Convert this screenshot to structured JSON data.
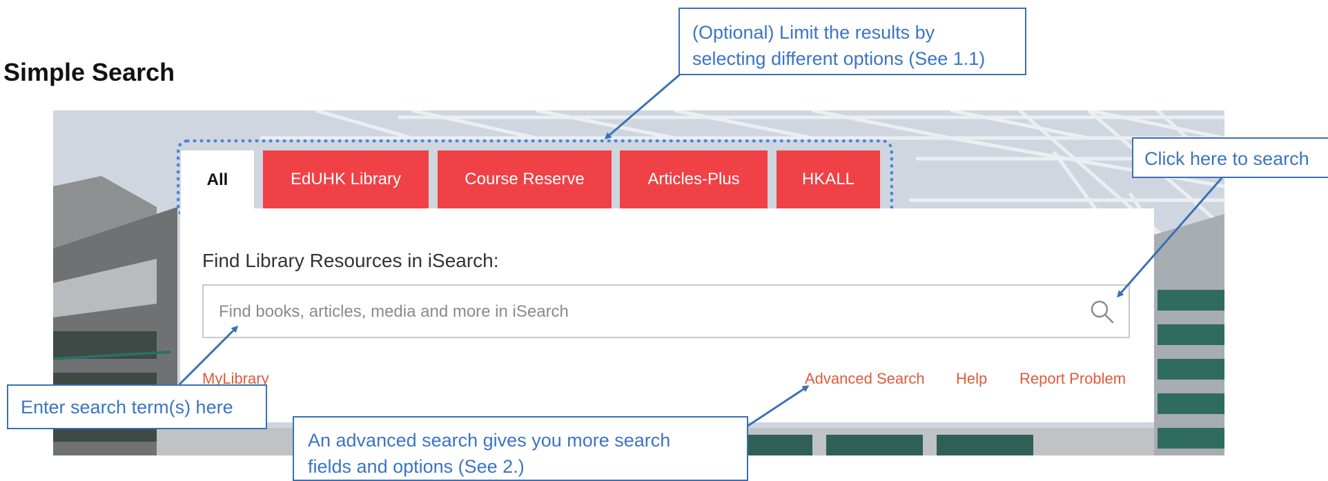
{
  "heading": "Simple Search",
  "tabs": [
    {
      "label": "All",
      "active": true
    },
    {
      "label": "EdUHK Library",
      "active": false
    },
    {
      "label": "Course Reserve",
      "active": false
    },
    {
      "label": "Articles-Plus",
      "active": false
    },
    {
      "label": "HKALL",
      "active": false
    }
  ],
  "search": {
    "label": "Find Library Resources in iSearch:",
    "placeholder": "Find books, articles, media and more in iSearch",
    "value": ""
  },
  "links": {
    "my_library": "MyLibrary",
    "advanced_search": "Advanced Search",
    "help": "Help",
    "report_problem": "Report Problem"
  },
  "callouts": {
    "limit_line1": "(Optional) Limit the results by",
    "limit_line2": "selecting different options (See 1.1)",
    "search_button": "Click here to search",
    "search_term": "Enter search term(s) here",
    "advanced_line1": " An advanced search gives you more search",
    "advanced_line2": "fields and options (See 2.)"
  },
  "colors": {
    "tab_red": "#ef4146",
    "link_orange": "#e05a3a",
    "callout_blue": "#3b74c4",
    "highlight_blue": "#4a86d8"
  }
}
